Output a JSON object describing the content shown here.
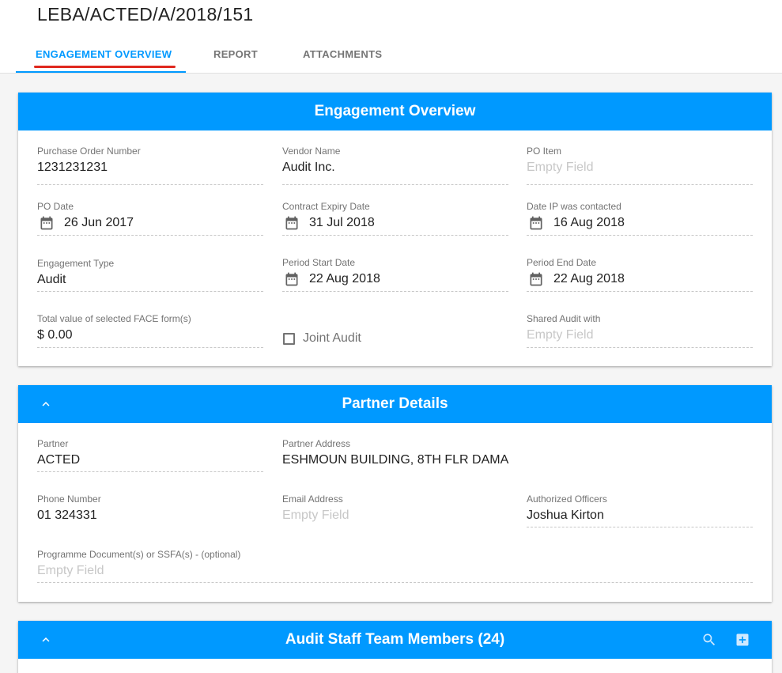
{
  "header": {
    "title": "LEBA/ACTED/A/2018/151",
    "tabs": [
      {
        "label": "ENGAGEMENT OVERVIEW",
        "active": true
      },
      {
        "label": "REPORT",
        "active": false
      },
      {
        "label": "ATTACHMENTS",
        "active": false
      }
    ]
  },
  "engagement": {
    "title": "Engagement Overview",
    "po_number": {
      "label": "Purchase Order Number",
      "value": "1231231231"
    },
    "vendor_name": {
      "label": "Vendor Name",
      "value": "Audit Inc."
    },
    "po_item": {
      "label": "PO Item",
      "placeholder": "Empty Field"
    },
    "po_date": {
      "label": "PO Date",
      "value": "26 Jun 2017"
    },
    "contract_expiry": {
      "label": "Contract Expiry Date",
      "value": "31 Jul 2018"
    },
    "date_ip_contacted": {
      "label": "Date IP was contacted",
      "value": "16 Aug 2018"
    },
    "engagement_type": {
      "label": "Engagement Type",
      "value": "Audit"
    },
    "period_start": {
      "label": "Period Start Date",
      "value": "22 Aug 2018"
    },
    "period_end": {
      "label": "Period End Date",
      "value": "22 Aug 2018"
    },
    "total_face": {
      "label": "Total value of selected FACE form(s)",
      "currency": "$",
      "value": "0.00"
    },
    "joint_audit": {
      "label": "Joint Audit",
      "checked": false
    },
    "shared_audit": {
      "label": "Shared Audit with",
      "placeholder": "Empty Field"
    }
  },
  "partner": {
    "title": "Partner Details",
    "partner": {
      "label": "Partner",
      "value": "ACTED"
    },
    "address": {
      "label": "Partner Address",
      "value": "ESHMOUN BUILDING, 8TH FLR DAMA"
    },
    "phone": {
      "label": "Phone Number",
      "value": "01 324331"
    },
    "email": {
      "label": "Email Address",
      "placeholder": "Empty Field"
    },
    "officers": {
      "label": "Authorized Officers",
      "value": "Joshua Kirton"
    },
    "programme_docs": {
      "label": "Programme Document(s) or SSFA(s) - (optional)",
      "placeholder": "Empty Field"
    }
  },
  "staff": {
    "title": "Audit Staff Team Members (24)"
  },
  "colors": {
    "accent": "#0099ff",
    "tab_indicator": "#e0281e",
    "empty_text": "#c7c7c7"
  },
  "icons": {
    "calendar": "calendar-icon",
    "collapse": "chevron-up-icon",
    "search": "search-icon",
    "add": "add-box-icon"
  }
}
